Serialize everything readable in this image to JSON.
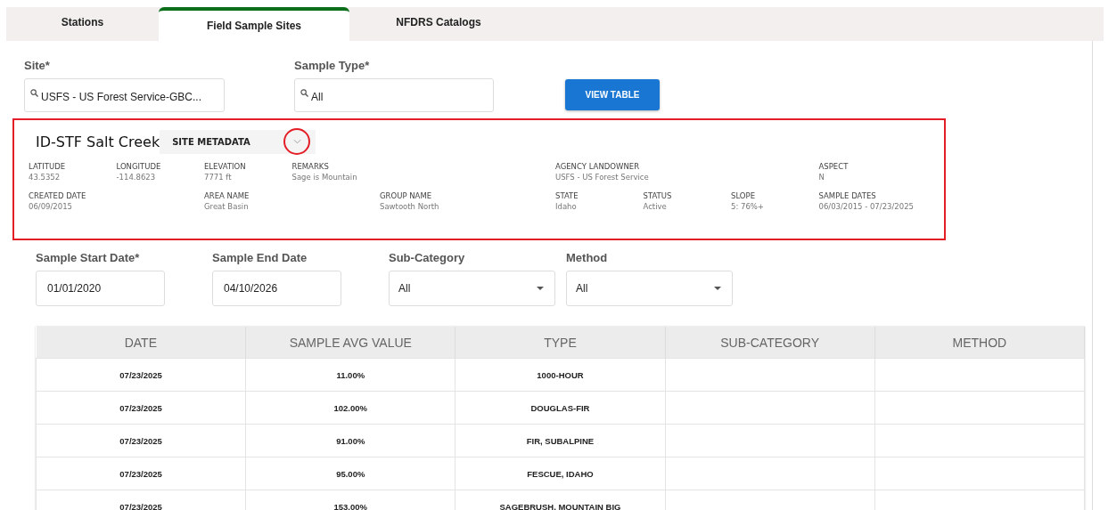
{
  "tabs": [
    {
      "label": "Stations",
      "selected": false
    },
    {
      "label": "Field Sample Sites",
      "selected": true
    },
    {
      "label": "NFDRS Catalogs",
      "selected": false
    }
  ],
  "site": {
    "label": "Site*",
    "value": "USFS - US Forest Service-GBC..."
  },
  "sample_type": {
    "label": "Sample Type*",
    "value": "All"
  },
  "view_button": "VIEW TABLE",
  "metadata": {
    "site_name": "ID-STF Salt Creek",
    "section": "SITE METADATA",
    "expanded": true,
    "rows": [
      [
        {
          "label": "LATITUDE",
          "value": "43.5352"
        },
        {
          "label": "LONGITUDE",
          "value": "-114.8623"
        },
        {
          "label": "ELEVATION",
          "value": "7771 ft"
        },
        {
          "label": "REMARKS",
          "value": "Sage is Mountain"
        },
        null,
        null,
        {
          "label": "AGENCY LANDOWNER",
          "value": "USFS - US Forest Service"
        },
        null,
        null,
        {
          "label": "ASPECT",
          "value": "N"
        }
      ],
      [
        {
          "label": "CREATED DATE",
          "value": "06/09/2015"
        },
        null,
        {
          "label": "AREA NAME",
          "value": "Great Basin"
        },
        null,
        {
          "label": "GROUP NAME",
          "value": "Sawtooth North"
        },
        null,
        {
          "label": "STATE",
          "value": "Idaho"
        },
        {
          "label": "STATUS",
          "value": "Active"
        },
        {
          "label": "SLOPE",
          "value": "5: 76%+"
        },
        {
          "label": "SAMPLE DATES",
          "value": "06/03/2015 - 07/23/2025"
        }
      ]
    ]
  },
  "filters": [
    {
      "kind": "date",
      "label": "Sample Start Date*",
      "value": "01/01/2020"
    },
    {
      "kind": "date",
      "label": "Sample End Date",
      "value": "04/10/2026"
    },
    {
      "kind": "select",
      "label": "Sub-Category",
      "value": "All"
    },
    {
      "kind": "select",
      "label": "Method",
      "value": "All"
    }
  ],
  "table": {
    "columns": [
      "DATE",
      "SAMPLE AVG VALUE",
      "TYPE",
      "SUB-CATEGORY",
      "METHOD"
    ],
    "rows": [
      [
        "07/23/2025",
        "11.00%",
        "1000-HOUR"
      ],
      [
        "07/23/2025",
        "102.00%",
        "DOUGLAS-FIR"
      ],
      [
        "07/23/2025",
        "91.00%",
        "FIR, SUBALPINE"
      ],
      [
        "07/23/2025",
        "95.00%",
        "FESCUE, IDAHO"
      ],
      [
        "07/23/2025",
        "153.00%",
        "SAGEBRUSH, MOUNTAIN BIG"
      ]
    ]
  }
}
